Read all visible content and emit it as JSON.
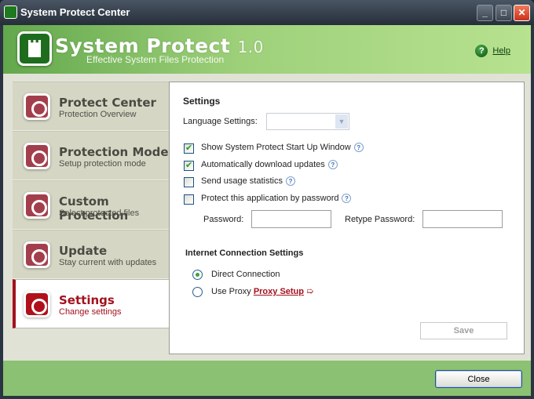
{
  "window": {
    "title": "System Protect Center",
    "minimize": "_",
    "maximize": "□",
    "close": "✕"
  },
  "header": {
    "brand": "System Protect",
    "version": "1.0",
    "tagline": "Effective System Files Protection",
    "help": "Help"
  },
  "sidebar": {
    "items": [
      {
        "title": "Protect Center",
        "subtitle": "Protection Overview",
        "active": false
      },
      {
        "title": "Protection Mode",
        "subtitle": "Setup protection mode",
        "active": false
      },
      {
        "title": "Custom Protection",
        "subtitle": "Select protected files",
        "active": false
      },
      {
        "title": "Update",
        "subtitle": "Stay current with updates",
        "active": false
      },
      {
        "title": "Settings",
        "subtitle": "Change settings",
        "active": true
      }
    ]
  },
  "settings": {
    "heading": "Settings",
    "language_label": "Language Settings:",
    "language_value": "",
    "options": [
      {
        "label": "Show System Protect Start Up Window",
        "checked": true
      },
      {
        "label": "Automatically download updates",
        "checked": true
      },
      {
        "label": "Send usage statistics",
        "checked": false
      },
      {
        "label": "Protect this application by password",
        "checked": false
      }
    ],
    "password_label": "Password:",
    "retype_label": "Retype Password:",
    "password_value": "",
    "retype_value": "",
    "internet_heading": "Internet Connection Settings",
    "direct": "Direct Connection",
    "use_proxy": "Use Proxy",
    "proxy_setup": "Proxy Setup",
    "proxy_arrow": "➯",
    "save": "Save",
    "help_glyph": "?"
  },
  "footer": {
    "close": "Close"
  }
}
